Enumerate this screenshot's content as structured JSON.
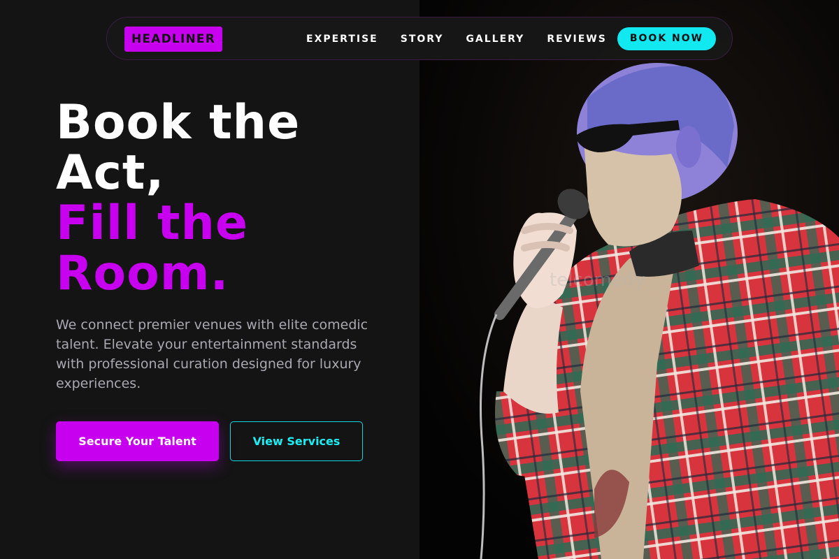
{
  "nav": {
    "logo": "HEADLINER",
    "links": [
      "EXPERTISE",
      "STORY",
      "GALLERY",
      "REVIEWS"
    ],
    "cta": "BOOK NOW"
  },
  "hero": {
    "headline_line1": "Book the",
    "headline_line2": "Act,",
    "headline_accent1": "Fill the",
    "headline_accent2": "Room.",
    "lead": "We connect premier venues with elite comedic talent. Elevate your entertainment standards with professional curation designed for luxury experiences.",
    "primary_cta": "Secure Your Talent",
    "secondary_cta": "View Services"
  },
  "photo": {
    "watermark": "telcomedy"
  },
  "colors": {
    "brand_purple": "#c800f0",
    "accent_cyan": "#12e8f0",
    "background": "#141414"
  }
}
